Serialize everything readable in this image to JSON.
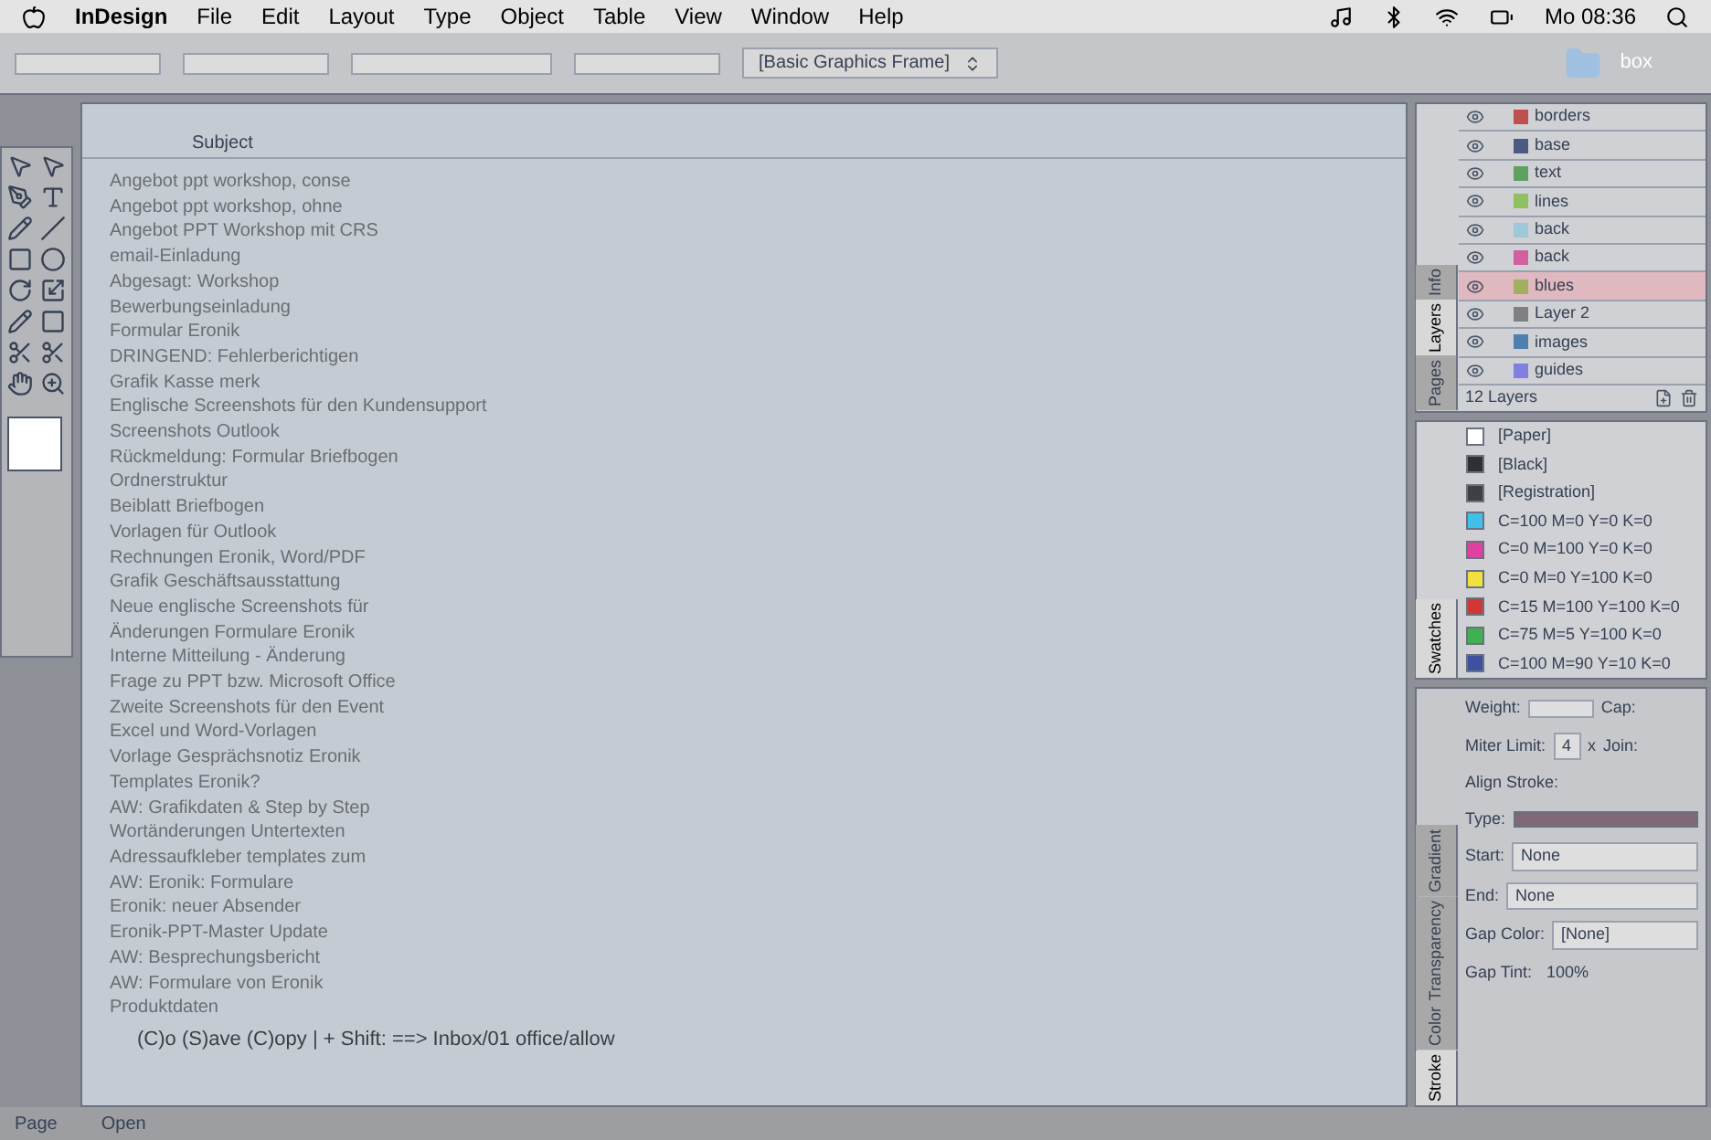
{
  "menu_bar": {
    "app": "InDesign",
    "items": [
      "File",
      "Edit",
      "Layout",
      "Type",
      "Object",
      "Table",
      "View",
      "Window",
      "Help"
    ],
    "clock": "Mo 08:36"
  },
  "control_bar": {
    "frame_style": "[Basic Graphics Frame]"
  },
  "desktop": {
    "folder": "box"
  },
  "mail_list": {
    "header": "Subject",
    "rows": [
      "Angebot ppt workshop, conse",
      "Angebot ppt workshop, ohne",
      "Angebot PPT Workshop mit CRS",
      "email-Einladung",
      "Abgesagt: Workshop",
      "Bewerbungseinladung",
      "Formular Eronik",
      "DRINGEND: Fehlerberichtigen",
      "Grafik Kasse merk",
      "Englische Screenshots für den Kundensupport",
      "Screenshots Outlook",
      "Rückmeldung: Formular Briefbogen",
      "Ordnerstruktur",
      "Beiblatt Briefbogen",
      "Vorlagen für Outlook",
      "Rechnungen Eronik, Word/PDF",
      "Grafik Geschäftsausstattung",
      "Neue englische Screenshots für",
      "Änderungen Formulare Eronik",
      "Interne Mitteilung - Änderung",
      "Frage zu PPT bzw. Microsoft Office",
      "Zweite Screenshots für den Event",
      "Excel und Word-Vorlagen",
      "Vorlage Gesprächsnotiz Eronik",
      "Templates Eronik?",
      "AW: Grafikdaten & Step by Step",
      "Wortänderungen Untertexten",
      "Adressaufkleber templates zum",
      "AW: Eronik: Formulare",
      "Eronik: neuer Absender",
      "Eronik-PPT-Master Update",
      "AW: Besprechungsbericht",
      "AW: Formulare von Eronik",
      "Produktdaten"
    ],
    "status_line": "(C)o (S)ave (C)opy | + Shift: ==> Inbox/01 office/allow"
  },
  "layers_panel": {
    "tabs": [
      {
        "label": "Info",
        "selected": false
      },
      {
        "label": "Layers",
        "selected": true
      },
      {
        "label": "Pages",
        "selected": false
      }
    ],
    "layers": [
      {
        "name": "borders",
        "color": "#c05050",
        "selected": false
      },
      {
        "name": "base",
        "color": "#4a5a80",
        "selected": false
      },
      {
        "name": "text",
        "color": "#60a060",
        "selected": false
      },
      {
        "name": "lines",
        "color": "#90c060",
        "selected": false
      },
      {
        "name": "back",
        "color": "#9fc8d8",
        "selected": false
      },
      {
        "name": "back",
        "color": "#d060a0",
        "selected": false
      },
      {
        "name": "blues",
        "color": "#a0b060",
        "selected": true
      },
      {
        "name": "Layer 2",
        "color": "#808080",
        "selected": false
      },
      {
        "name": "images",
        "color": "#5080b0",
        "selected": false
      },
      {
        "name": "guides",
        "color": "#8080e0",
        "selected": false
      }
    ],
    "count": "12 Layers"
  },
  "swatches_panel": {
    "tab": "Swatches",
    "swatches": [
      {
        "name": "[Paper]",
        "color": "#ffffff"
      },
      {
        "name": "[Black]",
        "color": "#303030"
      },
      {
        "name": "[Registration]",
        "color": "#404040"
      },
      {
        "name": "C=100 M=0 Y=0 K=0",
        "color": "#40c0e8"
      },
      {
        "name": "C=0 M=100 Y=0 K=0",
        "color": "#e040a0"
      },
      {
        "name": "C=0 M=0 Y=100 K=0",
        "color": "#f0e040"
      },
      {
        "name": "C=15 M=100 Y=100 K=0",
        "color": "#d03838"
      },
      {
        "name": "C=75 M=5 Y=100 K=0",
        "color": "#40b050"
      },
      {
        "name": "C=100 M=90 Y=10 K=0",
        "color": "#4050a0"
      }
    ]
  },
  "stroke_panel": {
    "tabs": [
      {
        "label": "Gradient",
        "selected": false
      },
      {
        "label": "Transparency",
        "selected": false
      },
      {
        "label": "Color",
        "selected": false
      },
      {
        "label": "Stroke",
        "selected": true
      }
    ],
    "weight_label": "Weight:",
    "cap_label": "Cap:",
    "miter_label": "Miter Limit:",
    "miter_value": "4",
    "times": "x",
    "join_label": "Join:",
    "align_label": "Align Stroke:",
    "type_label": "Type:",
    "start_label": "Start:",
    "start_value": "None",
    "end_label": "End:",
    "end_value": "None",
    "gap_color_label": "Gap Color:",
    "gap_color_value": "[None]",
    "gap_tint_label": "Gap Tint:",
    "gap_tint_value": "100%"
  },
  "footer": {
    "page": "Page",
    "open": "Open"
  }
}
